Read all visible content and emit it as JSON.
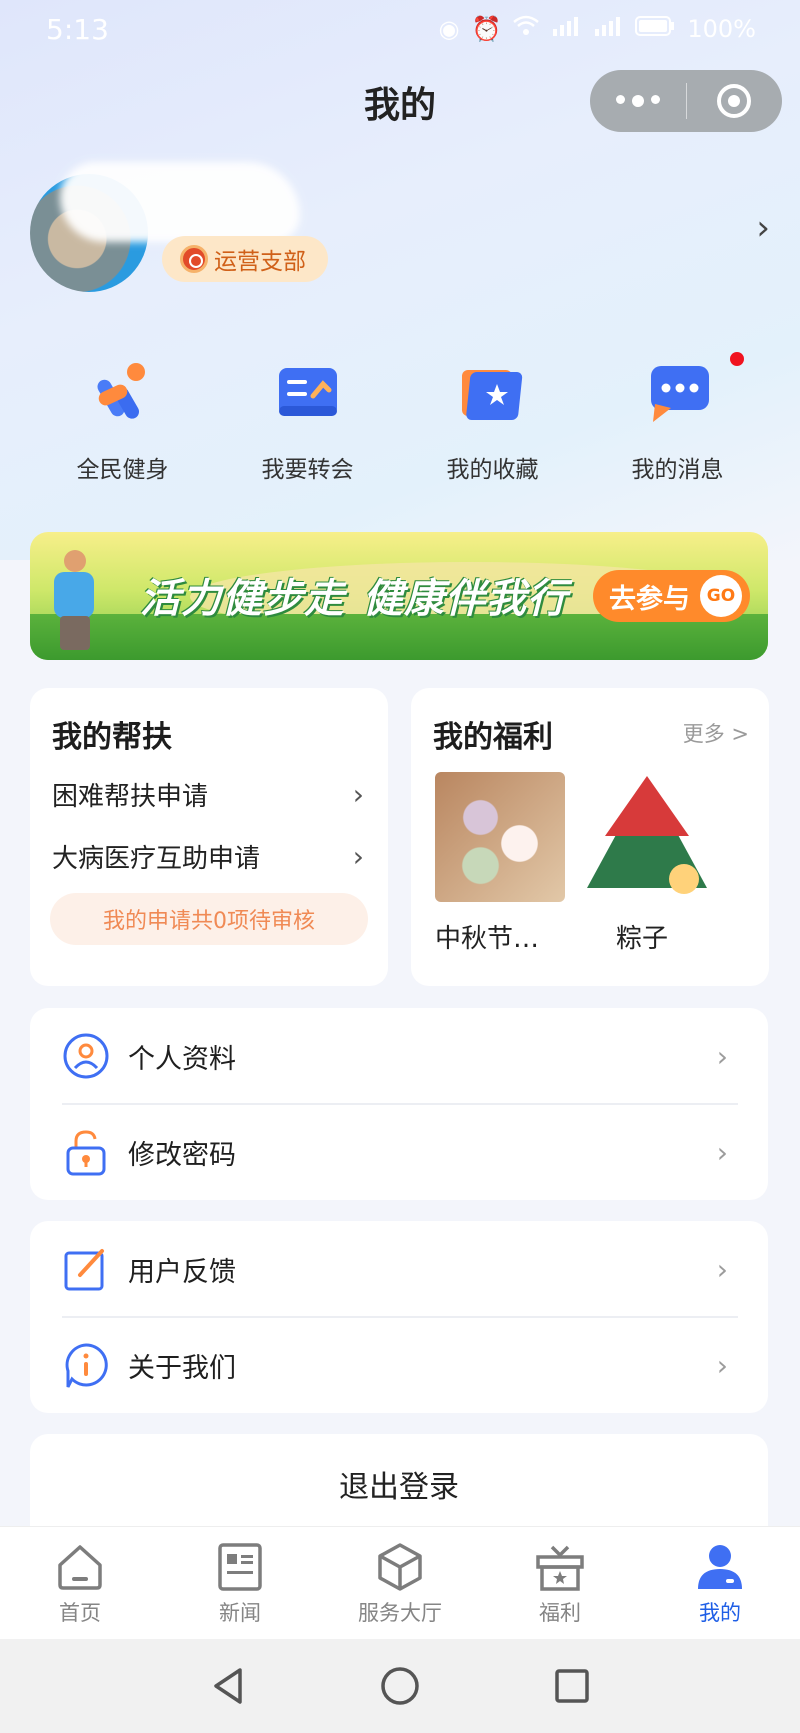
{
  "status_bar": {
    "time": "5:13",
    "battery": "100%"
  },
  "header": {
    "title": "我的"
  },
  "profile": {
    "department": "运营支部"
  },
  "quick_actions": [
    {
      "label": "全民健身",
      "icon": "fitness-icon"
    },
    {
      "label": "我要转会",
      "icon": "transfer-icon"
    },
    {
      "label": "我的收藏",
      "icon": "favorites-icon"
    },
    {
      "label": "我的消息",
      "icon": "messages-icon"
    }
  ],
  "banner": {
    "slogan_1": "活力健步走",
    "slogan_2": "健康伴我行",
    "cta": "去参与",
    "go": "GO"
  },
  "help": {
    "title": "我的帮扶",
    "items": [
      {
        "label": "困难帮扶申请"
      },
      {
        "label": "大病医疗互助申请"
      }
    ],
    "status": "我的申请共0项待审核"
  },
  "welfare": {
    "title": "我的福利",
    "more": "更多 >",
    "goods": [
      {
        "name": "中秋节…"
      },
      {
        "name": "粽子"
      }
    ]
  },
  "account_menu": [
    {
      "label": "个人资料"
    },
    {
      "label": "修改密码"
    }
  ],
  "support_menu": [
    {
      "label": "用户反馈"
    },
    {
      "label": "关于我们"
    }
  ],
  "logout": {
    "label": "退出登录"
  },
  "tabbar": [
    {
      "label": "首页"
    },
    {
      "label": "新闻"
    },
    {
      "label": "服务大厅"
    },
    {
      "label": "福利"
    },
    {
      "label": "我的",
      "active": true
    }
  ],
  "colors": {
    "accent": "#1e5ee6",
    "badge_bg": "#fde7c8",
    "badge_text": "#d06018",
    "status_text": "#f08a55"
  }
}
